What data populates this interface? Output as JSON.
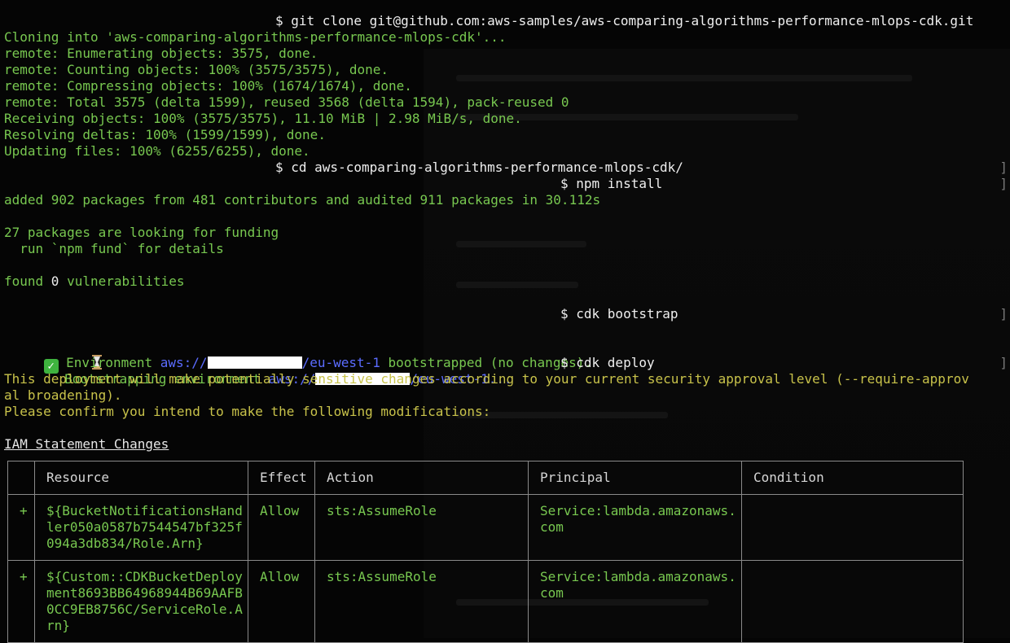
{
  "commands": {
    "git_clone": "$ git clone git@github.com:aws-samples/aws-comparing-algorithms-performance-mlops-cdk.git",
    "cd": "$ cd aws-comparing-algorithms-performance-mlops-cdk/",
    "npm_install": "$ npm install",
    "cdk_bootstrap": "$ cdk bootstrap",
    "cdk_deploy": "$ cdk deploy"
  },
  "output": {
    "clone": [
      "Cloning into 'aws-comparing-algorithms-performance-mlops-cdk'...",
      "remote: Enumerating objects: 3575, done.",
      "remote: Counting objects: 100% (3575/3575), done.",
      "remote: Compressing objects: 100% (1674/1674), done.",
      "remote: Total 3575 (delta 1599), reused 3568 (delta 1594), pack-reused 0",
      "Receiving objects: 100% (3575/3575), 11.10 MiB | 2.98 MiB/s, done.",
      "Resolving deltas: 100% (1599/1599), done.",
      "Updating files: 100% (6255/6255), done."
    ],
    "npm": {
      "added": "added 902 packages from 481 contributors and audited 911 packages in 30.112s",
      "funding": "27 packages are looking for funding",
      "fund_hint": "  run `npm fund` for details",
      "found_prefix": "found ",
      "found_count": "0",
      "found_suffix": " vulnerabilities"
    },
    "bootstrap": {
      "line1_text": " Bootstrapping environment ",
      "line1_url_prefix": "aws://",
      "line1_url_suffix": "/eu-west-1...",
      "line2_text": " Environment ",
      "line2_url_prefix": "aws://",
      "line2_url_suffix": "/eu-west-1",
      "line2_tail": " bootstrapped (no changes)."
    },
    "deploy": {
      "warning1": "This deployment will make potentially sensitive changes according to your current security approval level (--require-approv",
      "warning2": "al broadening).",
      "confirm": "Please confirm you intend to make the following modifications:",
      "section_title": "IAM Statement Changes"
    }
  },
  "iam_table": {
    "headers": [
      "",
      "Resource",
      "Effect",
      "Action",
      "Principal",
      "Condition"
    ],
    "rows": [
      {
        "sign": "+",
        "resource": "${BucketNotificationsHandler050a0587b7544547bf325f094a3db834/Role.Arn}",
        "effect": "Allow",
        "action": "sts:AssumeRole",
        "principal": "Service:lambda.amazonaws.com",
        "condition": ""
      },
      {
        "sign": "+",
        "resource": "${Custom::CDKBucketDeployment8693BB64968944B69AAFB0CC9EB8756C/ServiceRole.Arn}",
        "effect": "Allow",
        "action": "sts:AssumeRole",
        "principal": "Service:lambda.amazonaws.com",
        "condition": ""
      }
    ]
  },
  "colors": {
    "background": "#050505",
    "success_green": "#78c850",
    "warning_yellow": "#c8c24a",
    "url_blue": "#5b6cff"
  },
  "icons": [
    "hourglass-icon",
    "check-mark-icon"
  ]
}
